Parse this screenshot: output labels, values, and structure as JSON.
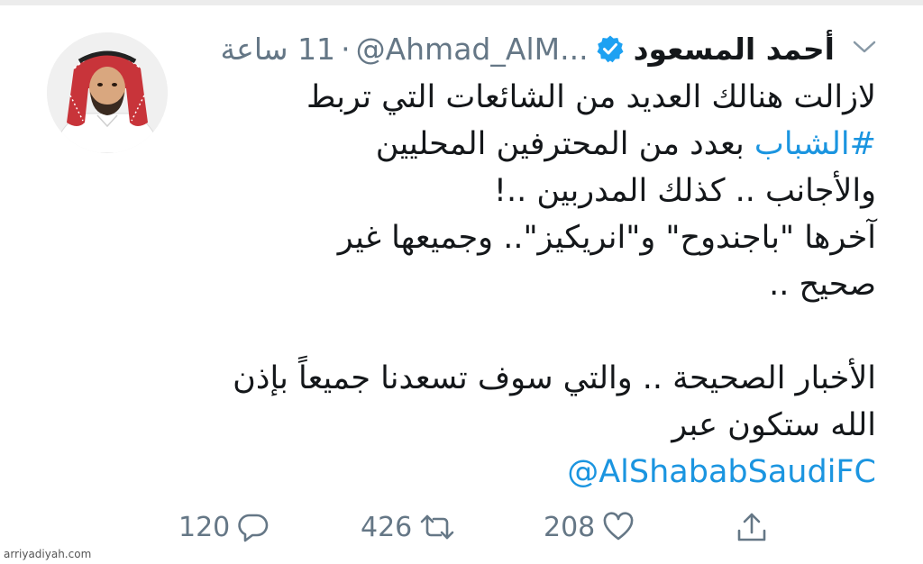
{
  "tweet": {
    "display_name": "أحمد المسعود",
    "handle": "@Ahmad_AlM...",
    "separator": "·",
    "time_ago": "11 ساعة",
    "verified": true,
    "body": {
      "line1": "لازالت هنالك العديد من الشائعات التي تربط",
      "line2_hashtag": "#الشباب",
      "line2_rest": " بعدد من المحترفين المحليين",
      "line3": "والأجانب .. كذلك المدربين ..!",
      "line4": "آخرها \"باجندوح\" و\"انريكيز\".. وجميعها غير",
      "line5": "صحيح ..",
      "line6": "الأخبار الصحيحة .. والتي سوف تسعدنا جميعاً بإذن",
      "line7": "الله ستكون عبر",
      "mention": "@AlShababSaudiFC"
    }
  },
  "actions": {
    "replies": "120",
    "retweets": "426",
    "likes": "208"
  },
  "colors": {
    "link": "#1b95e0",
    "muted": "#657786",
    "verified": "#1da1f2",
    "text": "#14171a"
  },
  "icons": {
    "menu": "chevron-down-icon",
    "verified": "verified-badge-icon",
    "reply": "reply-icon",
    "retweet": "retweet-icon",
    "like": "heart-icon",
    "share": "share-icon"
  },
  "watermark": "arriyadiyah.com"
}
